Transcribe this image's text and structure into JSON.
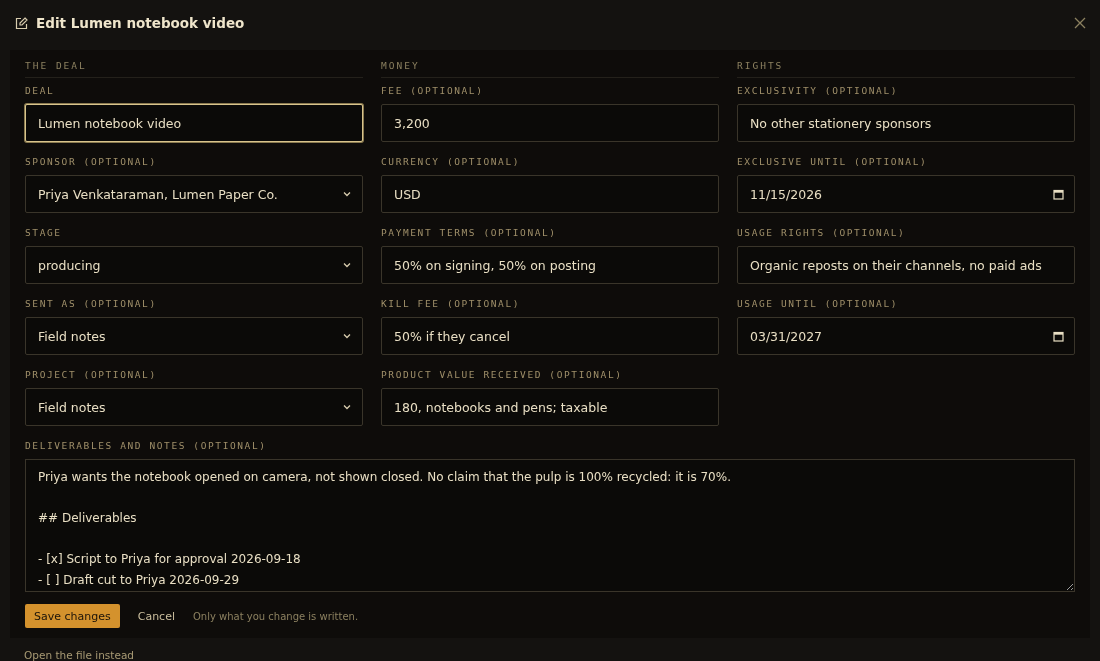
{
  "dialog": {
    "title": "Edit Lumen notebook video"
  },
  "sections": [
    {
      "heading": "THE DEAL",
      "fields": [
        {
          "label": "DEAL",
          "kind": "text",
          "value": "Lumen notebook video",
          "focused": true
        },
        {
          "label": "SPONSOR (OPTIONAL)",
          "kind": "select",
          "value": "Priya Venkataraman, Lumen Paper Co.",
          "focused": false
        },
        {
          "label": "STAGE",
          "kind": "select",
          "value": "producing",
          "focused": false
        },
        {
          "label": "SENT AS (OPTIONAL)",
          "kind": "select",
          "value": "Field notes",
          "focused": false
        },
        {
          "label": "PROJECT (OPTIONAL)",
          "kind": "select",
          "value": "Field notes",
          "focused": false
        }
      ]
    },
    {
      "heading": "MONEY",
      "fields": [
        {
          "label": "FEE (OPTIONAL)",
          "kind": "text",
          "value": "3,200",
          "focused": false
        },
        {
          "label": "CURRENCY (OPTIONAL)",
          "kind": "text",
          "value": "USD",
          "focused": false
        },
        {
          "label": "PAYMENT TERMS (OPTIONAL)",
          "kind": "text",
          "value": "50% on signing, 50% on posting",
          "focused": false
        },
        {
          "label": "KILL FEE (OPTIONAL)",
          "kind": "text",
          "value": "50% if they cancel",
          "focused": false
        },
        {
          "label": "PRODUCT VALUE RECEIVED (OPTIONAL)",
          "kind": "text",
          "value": "180, notebooks and pens; taxable",
          "focused": false
        }
      ]
    },
    {
      "heading": "RIGHTS",
      "fields": [
        {
          "label": "EXCLUSIVITY (OPTIONAL)",
          "kind": "text",
          "value": "No other stationery sponsors",
          "focused": false
        },
        {
          "label": "EXCLUSIVE UNTIL (OPTIONAL)",
          "kind": "date",
          "value": "11/15/2026",
          "focused": false
        },
        {
          "label": "USAGE RIGHTS (OPTIONAL)",
          "kind": "text",
          "value": "Organic reposts on their channels, no paid ads",
          "focused": false
        },
        {
          "label": "USAGE UNTIL (OPTIONAL)",
          "kind": "date",
          "value": "03/31/2027",
          "focused": false
        }
      ]
    }
  ],
  "notes": {
    "label": "DELIVERABLES AND NOTES (OPTIONAL)",
    "value": "Priya wants the notebook opened on camera, not shown closed. No claim that the pulp is 100% recycled: it is 70%.\n\n## Deliverables\n\n- [x] Script to Priya for approval 2026-09-18\n- [ ] Draft cut to Priya 2026-09-29"
  },
  "actions": {
    "save": "Save changes",
    "cancel": "Cancel",
    "hint": "Only what you change is written."
  },
  "footer_link": "Open the file instead"
}
